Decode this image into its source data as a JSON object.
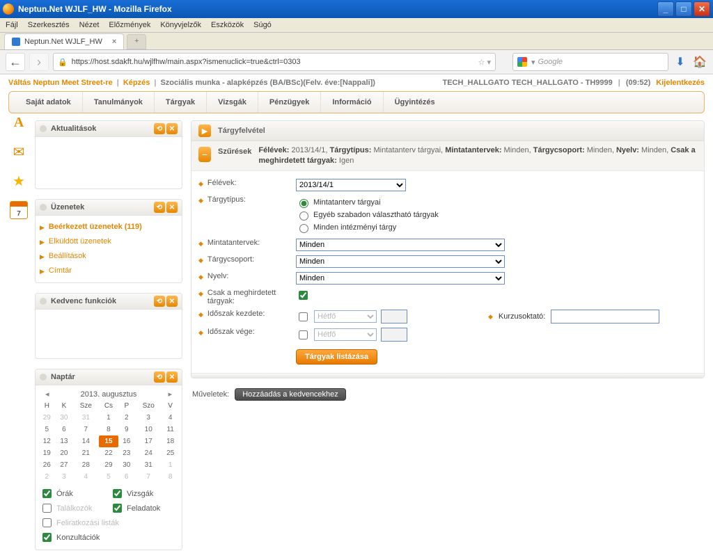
{
  "window": {
    "title": "Neptun.Net WJLF_HW - Mozilla Firefox"
  },
  "ff": {
    "menu": [
      "Fájl",
      "Szerkesztés",
      "Nézet",
      "Előzmények",
      "Könyvjelzők",
      "Eszközök",
      "Súgó"
    ],
    "tab": "Neptun.Net WJLF_HW",
    "url": "https://host.sdakft.hu/wjlfhw/main.aspx?ismenuclick=true&ctrl=0303",
    "search_placeholder": "Google"
  },
  "top": {
    "switch": "Váltás Neptun Meet Street-re",
    "kepzes": "Képzés",
    "program": "Szociális munka - alapképzés (BA/BSc)(Felv. éve:[Nappali])",
    "user": "TECH_HALLGATO TECH_HALLGATO - TH9999",
    "time": "(09:52)",
    "logout": "Kijelentkezés"
  },
  "nav": [
    "Saját adatok",
    "Tanulmányok",
    "Tárgyak",
    "Vizsgák",
    "Pénzügyek",
    "Információ",
    "Ügyintézés"
  ],
  "sideicons": {
    "cal_day": "7"
  },
  "widgets": {
    "aktual": "Aktualitások",
    "uzen": "Üzenetek",
    "uzen_items": [
      {
        "label": "Beérkezett üzenetek (119)",
        "strong": true
      },
      {
        "label": "Elküldött üzenetek",
        "strong": false
      },
      {
        "label": "Beállítások",
        "strong": false
      },
      {
        "label": "Címtár",
        "strong": false
      }
    ],
    "fav": "Kedvenc funkciók",
    "naptar": "Naptár"
  },
  "cal": {
    "month": "2013. augusztus",
    "dow": [
      "H",
      "K",
      "Sze",
      "Cs",
      "P",
      "Szo",
      "V"
    ],
    "weeks": [
      [
        {
          "d": 29,
          "dim": true
        },
        {
          "d": 30,
          "dim": true
        },
        {
          "d": 31,
          "dim": true
        },
        {
          "d": 1
        },
        {
          "d": 2
        },
        {
          "d": 3
        },
        {
          "d": 4
        }
      ],
      [
        {
          "d": 5
        },
        {
          "d": 6
        },
        {
          "d": 7
        },
        {
          "d": 8
        },
        {
          "d": 9
        },
        {
          "d": 10
        },
        {
          "d": 11
        }
      ],
      [
        {
          "d": 12
        },
        {
          "d": 13
        },
        {
          "d": 14
        },
        {
          "d": 15,
          "today": true
        },
        {
          "d": 16
        },
        {
          "d": 17
        },
        {
          "d": 18
        }
      ],
      [
        {
          "d": 19
        },
        {
          "d": 20
        },
        {
          "d": 21
        },
        {
          "d": 22
        },
        {
          "d": 23
        },
        {
          "d": 24
        },
        {
          "d": 25
        }
      ],
      [
        {
          "d": 26
        },
        {
          "d": 27
        },
        {
          "d": 28
        },
        {
          "d": 29
        },
        {
          "d": 30
        },
        {
          "d": 31
        },
        {
          "d": 1,
          "dim": true
        }
      ],
      [
        {
          "d": 2,
          "dim": true
        },
        {
          "d": 3,
          "dim": true
        },
        {
          "d": 4,
          "dim": true
        },
        {
          "d": 5,
          "dim": true
        },
        {
          "d": 6,
          "dim": true
        },
        {
          "d": 7,
          "dim": true
        },
        {
          "d": 8,
          "dim": true
        }
      ]
    ],
    "checks": {
      "orak": "Órák",
      "vizsgak": "Vizsgák",
      "talalkozok": "Találkozók",
      "feladatok": "Feladatok",
      "felirat": "Feliratkozási listák",
      "konz": "Konzultációk"
    }
  },
  "panel": {
    "title": "Tárgyfelvétel",
    "filter_label": "Szűrések",
    "filter_text_parts": {
      "p1": "Félévek:",
      "v1": " 2013/14/1, ",
      "p2": "Tárgytípus:",
      "v2": " Mintatanterv tárgyai, ",
      "p3": "Mintatantervek:",
      "v3": " Minden, ",
      "p4": "Tárgycsoport:",
      "v4": " Minden, ",
      "p5": "Nyelv:",
      "v5": " Minden, ",
      "p6": "Csak a meghirdetett tárgyak:",
      "v6": " Igen"
    },
    "labels": {
      "felevek": "Félévek:",
      "targytipus": "Tárgytípus:",
      "mintat": "Mintatantervek:",
      "tcsoport": "Tárgycsoport:",
      "nyelv": "Nyelv:",
      "csak": "Csak a meghirdetett tárgyak:",
      "ikezd": "Időszak kezdete:",
      "ivege": "Időszak vége:",
      "kurzus": "Kurzusoktató:"
    },
    "values": {
      "felevek": "2013/14/1",
      "mintat": "Minden",
      "tcsoport": "Minden",
      "nyelv": "Minden",
      "hetfo": "Hétfő"
    },
    "radios": {
      "r1": "Mintatanterv tárgyai",
      "r2": "Egyéb szabadon választható tárgyak",
      "r3": "Minden intézményi tárgy"
    },
    "btn": "Tárgyak listázása",
    "muv": "Műveletek:",
    "act": "Hozzáadás a kedvencekhez"
  }
}
